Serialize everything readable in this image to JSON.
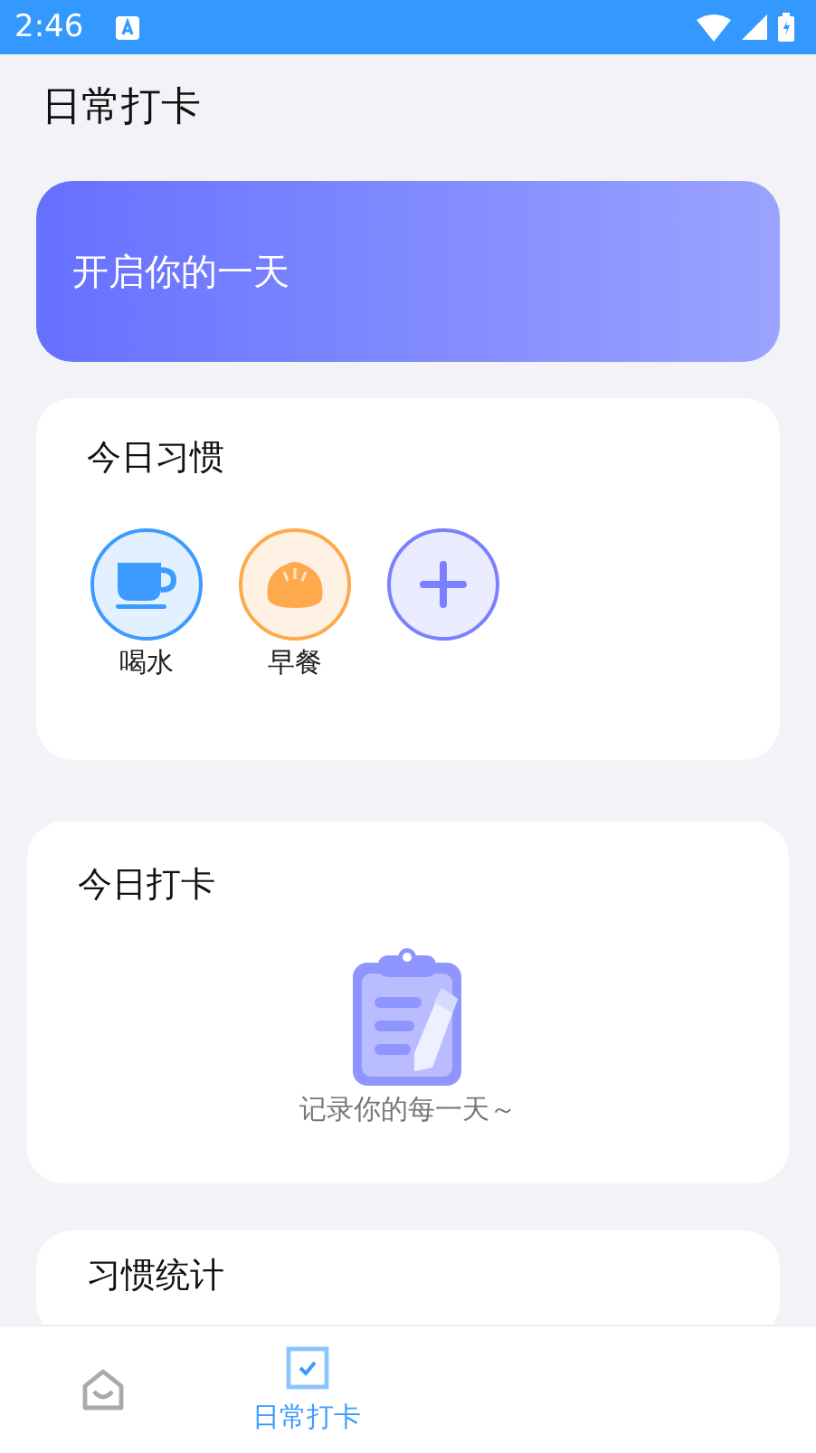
{
  "status_bar": {
    "time": "2:46"
  },
  "title": "日常打卡",
  "banner": {
    "text": "开启你的一天"
  },
  "habits": {
    "title": "今日习惯",
    "items": [
      {
        "kind": "cup",
        "label": "喝水",
        "color": "#3d9bff"
      },
      {
        "kind": "bun",
        "label": "早餐",
        "color": "#ffa94d"
      },
      {
        "kind": "add",
        "color": "#7a80ff"
      }
    ]
  },
  "checkin": {
    "title": "今日打卡",
    "empty_text": "记录你的每一天～"
  },
  "stats": {
    "title": "习惯统计"
  },
  "tabs": [
    {
      "kind": "home",
      "selected": false
    },
    {
      "kind": "check",
      "label": "日常打卡",
      "selected": true
    }
  ]
}
